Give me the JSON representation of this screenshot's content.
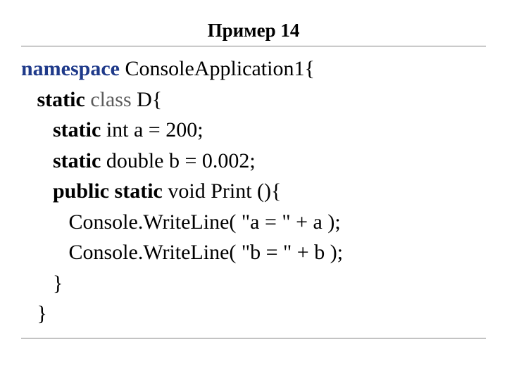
{
  "title": "Пример 14",
  "code": {
    "l1": {
      "kw": "namespace",
      "rest": " ConsoleApplication1{"
    },
    "l2": {
      "indent": "   ",
      "kw1": "static ",
      "kw2": "class",
      "rest": " D{"
    },
    "l3": {
      "indent": "      ",
      "kw": "static",
      "rest": " int a = 200;"
    },
    "l4": {
      "indent": "      ",
      "kw": "static",
      "rest": " double b = 0.002;"
    },
    "l5": {
      "indent": "      ",
      "kw": "public static",
      "rest": " void Print (){"
    },
    "l6": "         Console.WriteLine( \"a = \" + a );",
    "l7": "         Console.WriteLine( \"b = \" + b );",
    "l8": "      }",
    "l9": "   }"
  }
}
